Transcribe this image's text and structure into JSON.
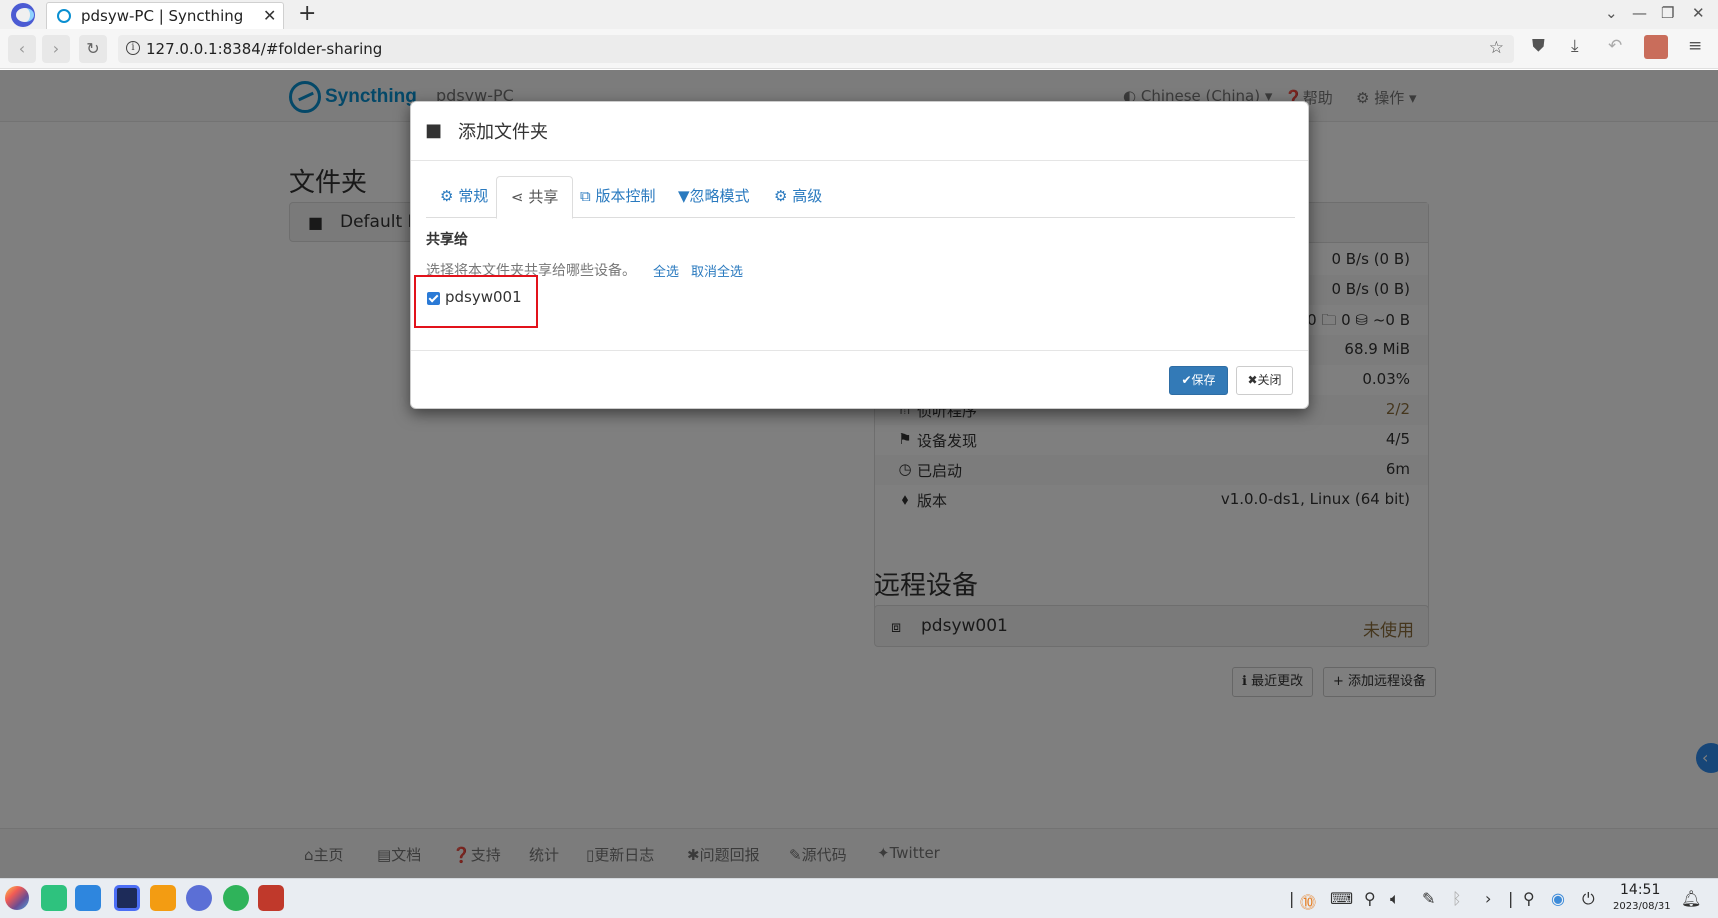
{
  "browser": {
    "tab_title": "pdsyw-PC | Syncthing",
    "tab_close": "✕",
    "new_tab": "+",
    "url": "127.0.0.1:8384/#folder-sharing",
    "win_min": "—",
    "win_restore": "❐",
    "win_close": "✕",
    "win_dropdown": "⌄"
  },
  "app": {
    "brand": "Syncthing",
    "device_name": "pdsyw-PC",
    "language": "Chinese (China)",
    "help": "帮助",
    "actions": "操作"
  },
  "folders": {
    "title": "文件夹",
    "items": [
      {
        "name": "Default Folder"
      }
    ]
  },
  "status": {
    "rows": [
      {
        "label": "",
        "value": "0 B/s (0 B)"
      },
      {
        "label": "",
        "value": "0 B/s (0 B)"
      },
      {
        "label": "",
        "value": "0  🗀 0  ⛁ ~0 B"
      },
      {
        "label": "",
        "value": "68.9 MiB"
      },
      {
        "label": "",
        "value": "0.03%"
      },
      {
        "label": "侦听程序",
        "value": "2/2"
      },
      {
        "label": "设备发现",
        "value": "4/5"
      },
      {
        "label": "已启动",
        "value": "6m"
      },
      {
        "label": "版本",
        "value": "v1.0.0-ds1, Linux (64 bit)"
      }
    ]
  },
  "remote": {
    "title": "远程设备",
    "devices": [
      {
        "name": "pdsyw001",
        "status": "未使用"
      }
    ],
    "recent_changes": "最近更改",
    "add_remote": "添加远程设备"
  },
  "footer": {
    "links": [
      "主页",
      "文档",
      "支持",
      "统计",
      "更新日志",
      "问题回报",
      "源代码",
      "Twitter"
    ]
  },
  "modal": {
    "title": "添加文件夹",
    "tabs": [
      "常规",
      "共享",
      "版本控制",
      "忽略模式",
      "高级"
    ],
    "active_tab": "共享",
    "share_heading": "共享给",
    "share_help": "选择将本文件夹共享给哪些设备。",
    "select_all": "全选",
    "deselect_all": "取消全选",
    "devices": [
      {
        "name": "pdsyw001",
        "checked": true
      }
    ],
    "save": "保存",
    "close": "关闭"
  },
  "taskbar": {
    "time": "14:51",
    "date": "2023/08/31"
  },
  "colors": {
    "primary": "#337ab7",
    "link": "#2a7abf",
    "brand": "#0891d1",
    "highlight": "#e2121b",
    "warning": "#8a6d3b"
  }
}
